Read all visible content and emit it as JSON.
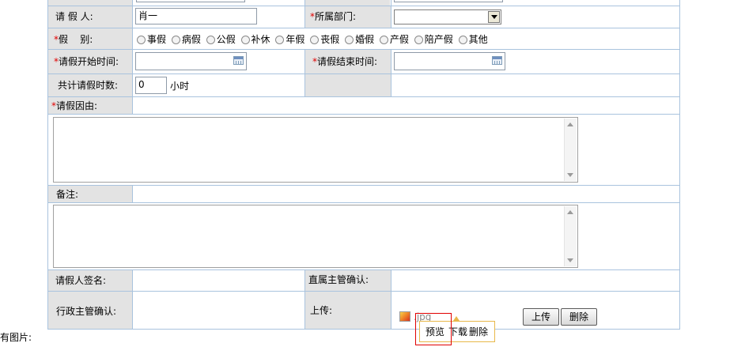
{
  "form": {
    "applicant_label": "请 假 人:",
    "applicant_value": "肖一",
    "department_label": "所属部门:",
    "department_value": "",
    "leave_type_label": "假      别:",
    "leave_types": [
      "事假",
      "病假",
      "公假",
      "补休",
      "年假",
      "丧假",
      "婚假",
      "产假",
      "陪产假",
      "其他"
    ],
    "start_time_label": "请假开始时间:",
    "start_time_value": "",
    "end_time_label": "请假结束时间:",
    "end_time_value": "",
    "total_hours_label": "共计请假时数:",
    "total_hours_value": "0",
    "hours_unit": "小时",
    "reason_label": "请假因由:",
    "reason_value": "",
    "remarks_label": "备注:",
    "remarks_value": "",
    "signature_label": "请假人签名:",
    "supervisor_label": "直属主管确认:",
    "admin_label": "行政主管确认:",
    "upload_label": "上传:",
    "file_name": ".jpg",
    "upload_button": "上传",
    "delete_button": "删除",
    "popup_preview": "预览",
    "popup_download": "下载",
    "popup_delete": "删除",
    "has_images_label": "有图片:"
  },
  "colors": {
    "grid_line": "#a9c3de",
    "label_bg": "#e3e3e3",
    "required": "#e00000",
    "highlight_box": "#e00000",
    "popup_border": "#e8b84a"
  }
}
